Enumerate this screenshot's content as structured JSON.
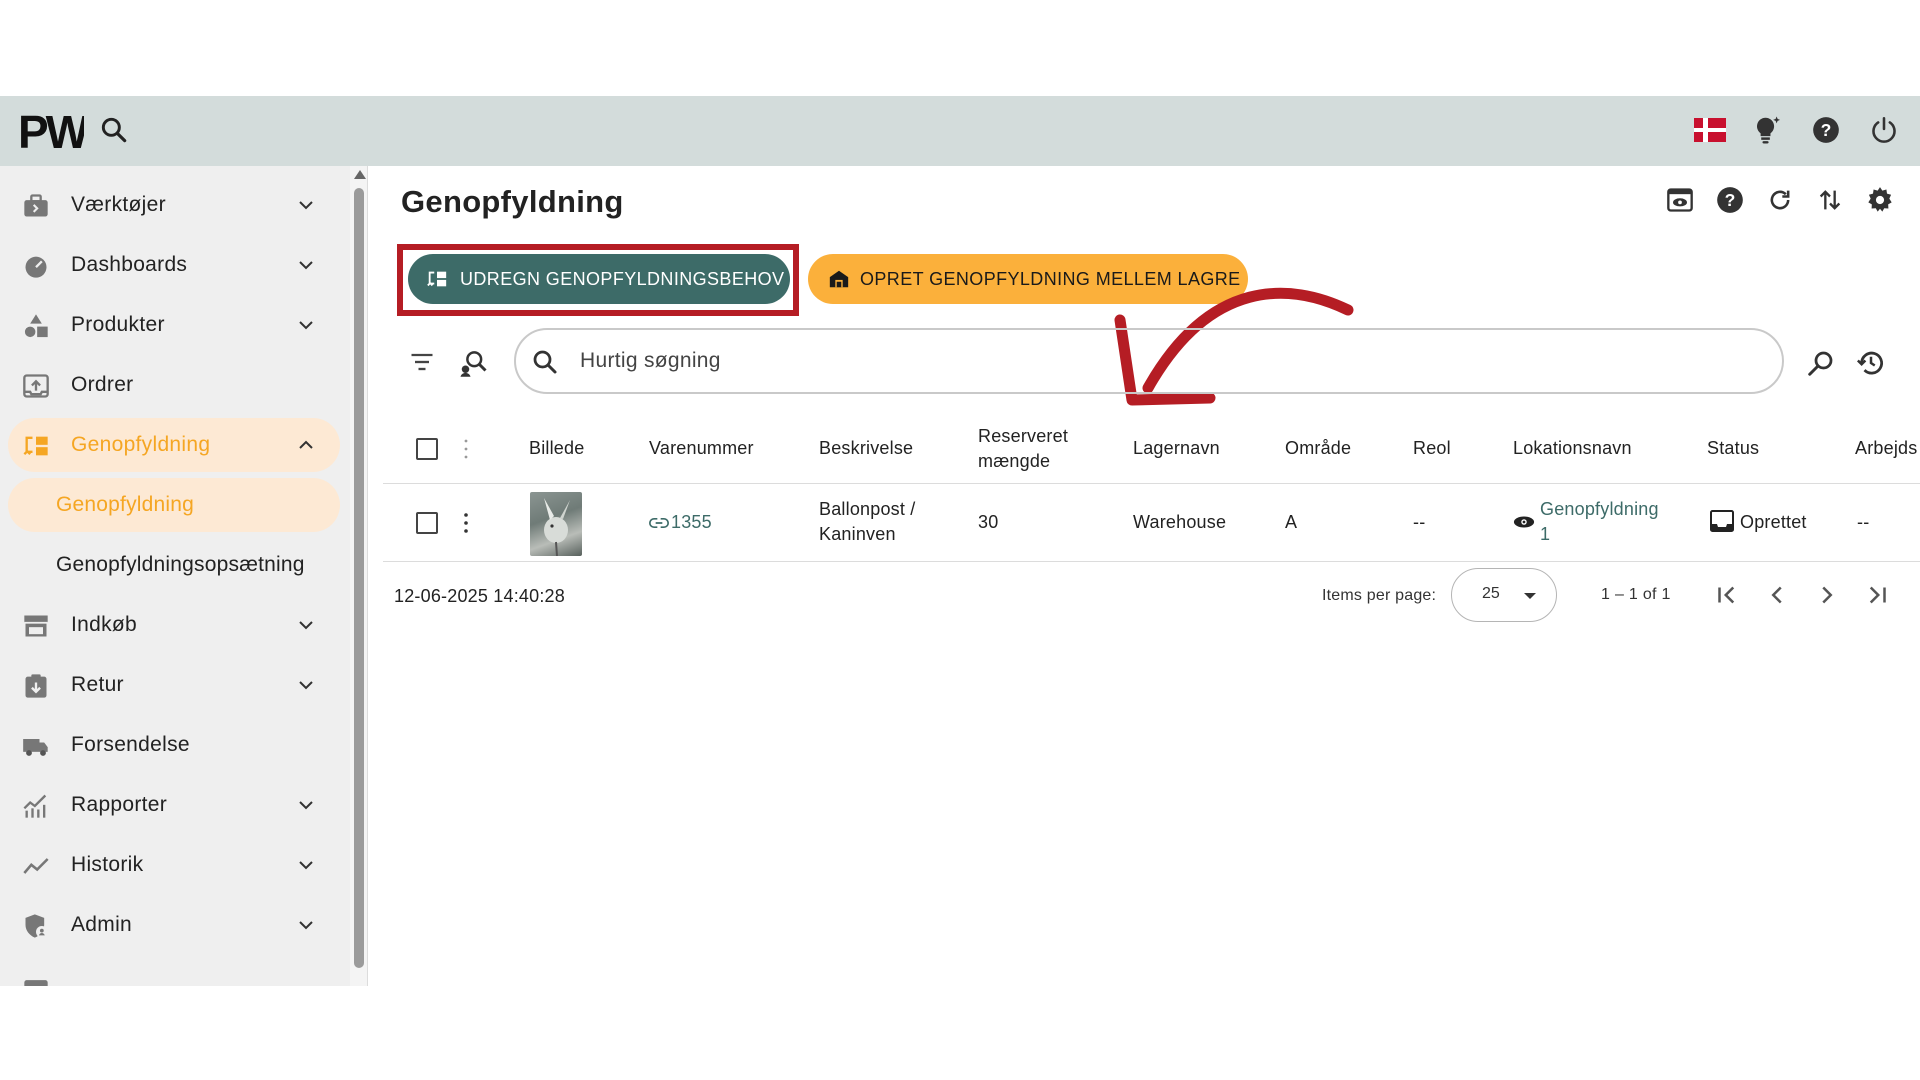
{
  "topbar": {
    "logo_text": "PW",
    "search_icon": "search-icon",
    "right_icons": [
      "danish-flag-icon",
      "lightbulb-icon",
      "help-icon",
      "power-icon"
    ]
  },
  "sidebar": {
    "items": [
      {
        "label": "Værktøjer",
        "icon": "briefcase-icon",
        "expandable": true
      },
      {
        "label": "Dashboards",
        "icon": "gauge-icon",
        "expandable": true
      },
      {
        "label": "Produkter",
        "icon": "shapes-icon",
        "expandable": true
      },
      {
        "label": "Ordrer",
        "icon": "inbox-upload-icon",
        "expandable": false
      },
      {
        "label": "Genopfyldning",
        "icon": "replenish-icon",
        "expandable": true,
        "active": true
      },
      {
        "label": "Indkøb",
        "icon": "store-icon",
        "expandable": true
      },
      {
        "label": "Retur",
        "icon": "return-box-icon",
        "expandable": true
      },
      {
        "label": "Forsendelse",
        "icon": "truck-icon",
        "expandable": false
      },
      {
        "label": "Rapporter",
        "icon": "chart-icon",
        "expandable": true
      },
      {
        "label": "Historik",
        "icon": "trend-icon",
        "expandable": true
      },
      {
        "label": "Admin",
        "icon": "shield-user-icon",
        "expandable": true
      }
    ],
    "sub_items": [
      {
        "label": "Genopfyldning",
        "active": true
      },
      {
        "label": "Genopfyldningsopsætning",
        "active": false
      }
    ]
  },
  "main": {
    "title": "Genopfyldning",
    "header_icons": [
      "preview-icon",
      "help-icon",
      "refresh-icon",
      "sort-icon",
      "settings-icon"
    ],
    "primary_button": "UDREGN GENOPFYLDNINGSBEHOV",
    "secondary_button": "OPRET GENOPFYLDNING MELLEM LAGRE",
    "search_placeholder": "Hurtig søgning",
    "table": {
      "headers": {
        "image": "Billede",
        "sku": "Varenummer",
        "description": "Beskrivelse",
        "reserved_qty_1": "Reserveret",
        "reserved_qty_2": "mængde",
        "warehouse": "Lagernavn",
        "area": "Område",
        "shelf": "Reol",
        "location": "Lokationsnavn",
        "status": "Status",
        "work": "Arbejds"
      },
      "rows": [
        {
          "sku": "1355",
          "description_1": "Ballonpost /",
          "description_2": "Kaninven",
          "reserved": "30",
          "warehouse": "Warehouse",
          "area": "A",
          "shelf": "--",
          "location_1": "Genopfyldning",
          "location_2": "1",
          "status": "Oprettet",
          "work": "--"
        }
      ]
    },
    "footer": {
      "timestamp": "12-06-2025 14:40:28",
      "items_per_page_label": "Items per page:",
      "items_per_page_value": "25",
      "range": "1 – 1 of 1"
    }
  },
  "colors": {
    "topbar": "#d3dcdb",
    "sidebar": "#efefef",
    "accent_orange": "#f5a623",
    "active_bg": "#fde9d4",
    "primary_button": "#3d6b68",
    "secondary_button": "#fbb03b",
    "annotation_red": "#b51d24"
  }
}
